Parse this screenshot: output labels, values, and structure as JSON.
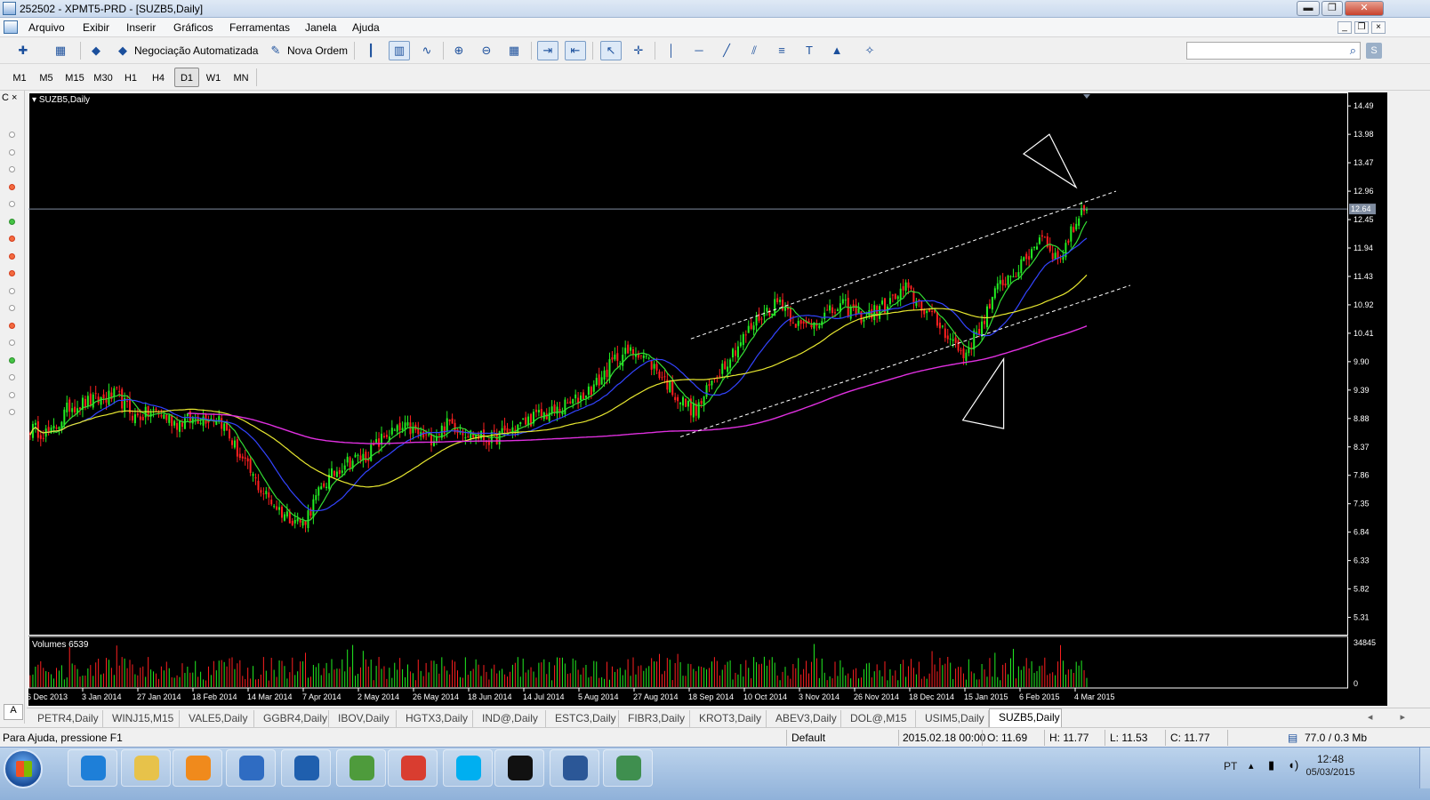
{
  "window": {
    "title": "252502 - XPMT5-PRD - [SUZB5,Daily]",
    "controls": {
      "minimize": "▬",
      "restore": "❐",
      "close": "✕"
    },
    "mdi_controls": {
      "minimize": "_",
      "restore": "❐",
      "close": "×"
    }
  },
  "menu": {
    "items": [
      "Arquivo",
      "Exibir",
      "Inserir",
      "Gráficos",
      "Ferramentas",
      "Janela",
      "Ajuda"
    ]
  },
  "toolbar": {
    "auto_trading_label": "Negociação Automatizada",
    "new_order_label": "Nova Ordem",
    "search_placeholder": "",
    "icons": {
      "new-chart": "✚",
      "profiles": "▦",
      "auto-trading": "◆",
      "new-order": "✎",
      "bar-chart": "┃",
      "candles": "▥",
      "line-chart": "∿",
      "zoom-in": "⊕",
      "zoom-out": "⊖",
      "tile": "▦",
      "autoscroll": "⇥",
      "shift": "⇤",
      "cursor": "↖",
      "crosshair": "✛",
      "vline": "│",
      "hline": "─",
      "trendline": "╱",
      "channel": "⫽",
      "fibo": "≡",
      "text": "T",
      "triangle": "▲",
      "more": "✧"
    },
    "search_icon": "⌕",
    "s_badge": "S"
  },
  "timeframes": {
    "items": [
      "M1",
      "M5",
      "M15",
      "M30",
      "H1",
      "H4",
      "D1",
      "W1",
      "MN"
    ],
    "active": "D1"
  },
  "left_panel": {
    "header": "C ×",
    "dots": [
      "gray",
      "gray",
      "gray",
      "red",
      "gray",
      "green",
      "red",
      "red",
      "red",
      "gray",
      "gray",
      "red",
      "gray",
      "green",
      "gray",
      "gray",
      "gray"
    ],
    "tab_label": "A"
  },
  "chart": {
    "symbol_label": "SUZB5,Daily",
    "volume_label": "Volumes 6539",
    "current_price": "12.64",
    "price_ticks": [
      "14.49",
      "13.98",
      "13.47",
      "12.96",
      "12.45",
      "11.94",
      "11.43",
      "10.92",
      "10.41",
      "9.90",
      "9.39",
      "8.88",
      "8.37",
      "7.86",
      "7.35",
      "6.84",
      "6.33",
      "5.82",
      "5.31"
    ],
    "volume_ticks": [
      "34845",
      "0"
    ],
    "date_ticks": [
      "6 Dec 2013",
      "3 Jan 2014",
      "27 Jan 2014",
      "18 Feb 2014",
      "14 Mar 2014",
      "7 Apr 2014",
      "2 May 2014",
      "26 May 2014",
      "18 Jun 2014",
      "14 Jul 2014",
      "5 Aug 2014",
      "27 Aug 2014",
      "18 Sep 2014",
      "10 Oct 2014",
      "3 Nov 2014",
      "26 Nov 2014",
      "18 Dec 2014",
      "15 Jan 2015",
      "6 Feb 2015",
      "4 Mar 2015"
    ],
    "colors": {
      "background": "#000000",
      "bull": "#22ee22",
      "bear": "#ff2020",
      "ma_fast": "#33dd33",
      "ma_mid": "#3344ff",
      "ma_slow": "#e8e830",
      "ma_long": "#e030e0",
      "price_line": "#7f8ca0"
    }
  },
  "chart_data": {
    "type": "line",
    "title": "SUZB5,Daily",
    "y_range": [
      5.0,
      14.7
    ],
    "current_price": 12.64,
    "price_anchors": [
      [
        0,
        8.7
      ],
      [
        8,
        8.6
      ],
      [
        15,
        9.1
      ],
      [
        25,
        9.2
      ],
      [
        33,
        9.3
      ],
      [
        40,
        8.9
      ],
      [
        48,
        9.0
      ],
      [
        56,
        8.8
      ],
      [
        64,
        8.9
      ],
      [
        72,
        8.9
      ],
      [
        80,
        8.2
      ],
      [
        88,
        7.6
      ],
      [
        96,
        7.2
      ],
      [
        104,
        7.0
      ],
      [
        112,
        7.7
      ],
      [
        120,
        8.1
      ],
      [
        128,
        8.2
      ],
      [
        136,
        8.6
      ],
      [
        144,
        8.7
      ],
      [
        152,
        8.5
      ],
      [
        160,
        8.8
      ],
      [
        168,
        8.6
      ],
      [
        176,
        8.5
      ],
      [
        184,
        8.7
      ],
      [
        192,
        8.9
      ],
      [
        200,
        9.0
      ],
      [
        208,
        9.2
      ],
      [
        216,
        9.5
      ],
      [
        224,
        10.0
      ],
      [
        232,
        10.1
      ],
      [
        240,
        9.7
      ],
      [
        248,
        9.2
      ],
      [
        254,
        9.0
      ],
      [
        262,
        9.7
      ],
      [
        270,
        10.2
      ],
      [
        278,
        10.7
      ],
      [
        286,
        11.0
      ],
      [
        294,
        10.5
      ],
      [
        302,
        10.7
      ],
      [
        310,
        10.9
      ],
      [
        318,
        10.7
      ],
      [
        326,
        10.9
      ],
      [
        334,
        11.2
      ],
      [
        342,
        10.8
      ],
      [
        350,
        10.4
      ],
      [
        356,
        10.0
      ],
      [
        362,
        10.5
      ],
      [
        370,
        11.3
      ],
      [
        378,
        11.6
      ],
      [
        386,
        12.2
      ],
      [
        392,
        11.7
      ],
      [
        398,
        12.3
      ],
      [
        403,
        12.85
      ]
    ],
    "candle_count": 404,
    "volume_max": 34845,
    "series": []
  },
  "tabs": {
    "items": [
      "PETR4,Daily",
      "WINJ15,M15",
      "VALE5,Daily",
      "GGBR4,Daily",
      "IBOV,Daily",
      "HGTX3,Daily",
      "IND@,Daily",
      "ESTC3,Daily",
      "FIBR3,Daily",
      "KROT3,Daily",
      "ABEV3,Daily",
      "DOL@,M15",
      "USIM5,Daily",
      "SUZB5,Daily"
    ],
    "active": "SUZB5,Daily",
    "arrows": "◂ ▸"
  },
  "status": {
    "help": "Para Ajuda, pressione F1",
    "profile": "Default",
    "datetime": "2015.02.18 00:00",
    "open": "O: 11.69",
    "high": "H: 11.77",
    "low": "L: 11.53",
    "close": "C: 11.77",
    "traffic": "77.0 / 0.3 Mb"
  },
  "taskbar": {
    "apps": [
      {
        "name": "internet-explorer",
        "color": "#1e7fd8"
      },
      {
        "name": "file-explorer",
        "color": "#e7c24a"
      },
      {
        "name": "media-player",
        "color": "#f08a1c"
      },
      {
        "name": "remote-desktop",
        "color": "#2f6cc2"
      },
      {
        "name": "hp-utility",
        "color": "#1f5fae"
      },
      {
        "name": "shared-folder",
        "color": "#4e9b3c"
      },
      {
        "name": "chrome",
        "color": "#d93d30"
      },
      {
        "name": "skype",
        "color": "#00aff0"
      },
      {
        "name": "xp-investimentos",
        "color": "#111111"
      },
      {
        "name": "word",
        "color": "#2b5797"
      },
      {
        "name": "metatrader",
        "color": "#3f8f4f"
      }
    ],
    "language": "PT",
    "time": "12:48",
    "date": "05/03/2015"
  }
}
